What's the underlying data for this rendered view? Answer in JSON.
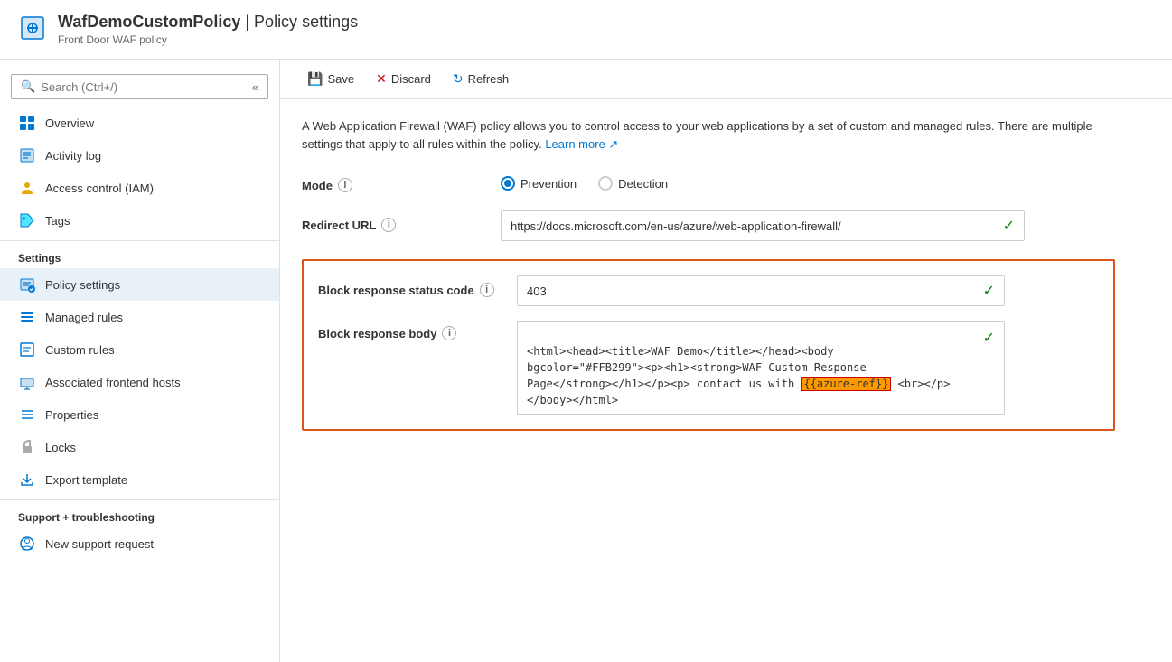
{
  "header": {
    "title": "WafDemoCustomPolicy",
    "separator": " | ",
    "page": "Policy settings",
    "subtitle": "Front Door WAF policy"
  },
  "toolbar": {
    "save_label": "Save",
    "discard_label": "Discard",
    "refresh_label": "Refresh"
  },
  "sidebar": {
    "search_placeholder": "Search (Ctrl+/)",
    "nav_items": [
      {
        "id": "overview",
        "label": "Overview",
        "icon": "overview"
      },
      {
        "id": "activity-log",
        "label": "Activity log",
        "icon": "activity"
      },
      {
        "id": "iam",
        "label": "Access control (IAM)",
        "icon": "iam"
      },
      {
        "id": "tags",
        "label": "Tags",
        "icon": "tags"
      }
    ],
    "settings_section": "Settings",
    "settings_items": [
      {
        "id": "policy-settings",
        "label": "Policy settings",
        "icon": "policy",
        "active": true
      },
      {
        "id": "managed-rules",
        "label": "Managed rules",
        "icon": "managed"
      },
      {
        "id": "custom-rules",
        "label": "Custom rules",
        "icon": "custom"
      },
      {
        "id": "associated-frontend",
        "label": "Associated frontend hosts",
        "icon": "assoc"
      },
      {
        "id": "properties",
        "label": "Properties",
        "icon": "props"
      },
      {
        "id": "locks",
        "label": "Locks",
        "icon": "locks"
      },
      {
        "id": "export",
        "label": "Export template",
        "icon": "export"
      }
    ],
    "support_section": "Support + troubleshooting",
    "support_items": [
      {
        "id": "new-support",
        "label": "New support request",
        "icon": "support"
      }
    ]
  },
  "content": {
    "description": "A Web Application Firewall (WAF) policy allows you to control access to your web applications by a set of custom and managed rules. There are multiple settings that apply to all rules within the policy.",
    "learn_more_label": "Learn more",
    "mode_label": "Mode",
    "mode_options": [
      {
        "id": "prevention",
        "label": "Prevention",
        "selected": true
      },
      {
        "id": "detection",
        "label": "Detection",
        "selected": false
      }
    ],
    "redirect_url_label": "Redirect URL",
    "redirect_url_value": "https://docs.microsoft.com/en-us/azure/web-application-firewall/",
    "block_status_label": "Block response status code",
    "block_status_value": "403",
    "block_body_label": "Block response body",
    "block_body_value": "<html><head><title>WAF Demo</title></head><body bgcolor=\"#FFB299\"><p><h1><strong>WAF Custom Response Page</strong></h1></p><p> contact us with {{azure-ref}} <br></p></body></html>",
    "block_body_display": "<html><head><title>WAF Demo</title></head><body\nbgcolor=\"#FFB299\"><p><h1><strong>WAF Custom Response\nPage</strong></h1></p><p> contact us with {{azure-ref}} <br></p>\n</body></html>"
  }
}
